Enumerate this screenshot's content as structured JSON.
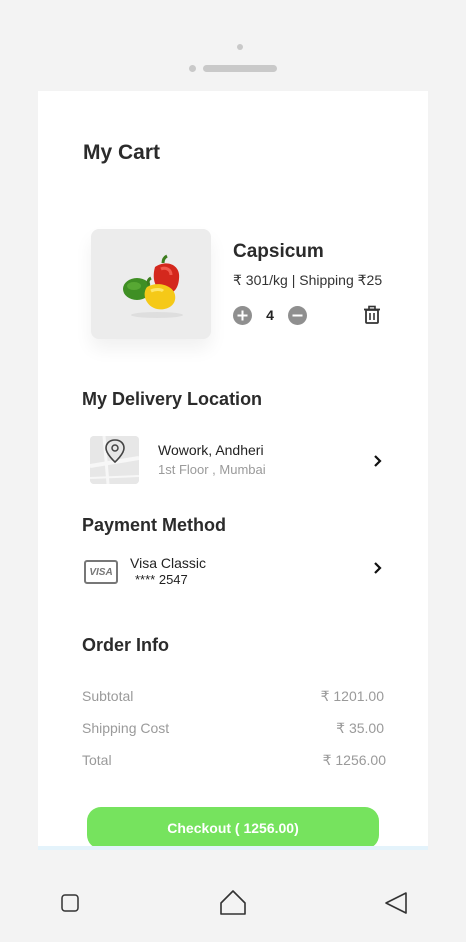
{
  "cart": {
    "title": "My Cart",
    "item": {
      "name": "Capsicum",
      "price_line": "₹ 301/kg | Shipping ₹25",
      "quantity": "4",
      "image_icon": "bell-peppers-image"
    }
  },
  "delivery": {
    "section_title": "My Delivery Location",
    "line1": "Wowork, Andheri",
    "line2": "1st Floor , Mumbai"
  },
  "payment": {
    "section_title": "Payment Method",
    "card_logo": "VISA",
    "card_name": "Visa Classic",
    "card_number": "**** 2547"
  },
  "order_info": {
    "section_title": "Order Info",
    "rows": [
      {
        "label": "Subtotal",
        "value": "₹ 1201.00"
      },
      {
        "label": "Shipping Cost",
        "value": "₹ 35.00"
      },
      {
        "label": "Total",
        "value": "₹ 1256.00"
      }
    ]
  },
  "checkout": {
    "label": "Checkout ( 1256.00)"
  },
  "colors": {
    "accent": "#76e35e",
    "background": "#ffffff",
    "text": "#2b2b2b",
    "muted": "#9a9a9a"
  }
}
